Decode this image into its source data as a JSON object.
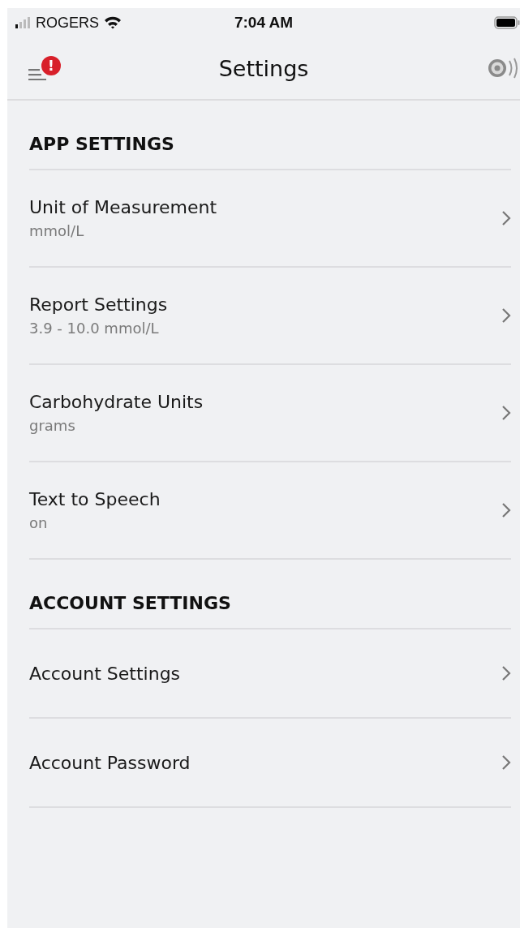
{
  "status_bar": {
    "carrier": "ROGERS",
    "time": "7:04 AM"
  },
  "nav": {
    "title": "Settings",
    "menu_badge": "!"
  },
  "sections": [
    {
      "title": "APP SETTINGS",
      "items": [
        {
          "label": "Unit of Measurement",
          "value": "mmol/L"
        },
        {
          "label": "Report Settings",
          "value": "3.9 - 10.0 mmol/L"
        },
        {
          "label": "Carbohydrate Units",
          "value": "grams"
        },
        {
          "label": "Text to Speech",
          "value": "on"
        }
      ]
    },
    {
      "title": "ACCOUNT SETTINGS",
      "items": [
        {
          "label": "Account Settings"
        },
        {
          "label": "Account Password"
        }
      ]
    }
  ]
}
